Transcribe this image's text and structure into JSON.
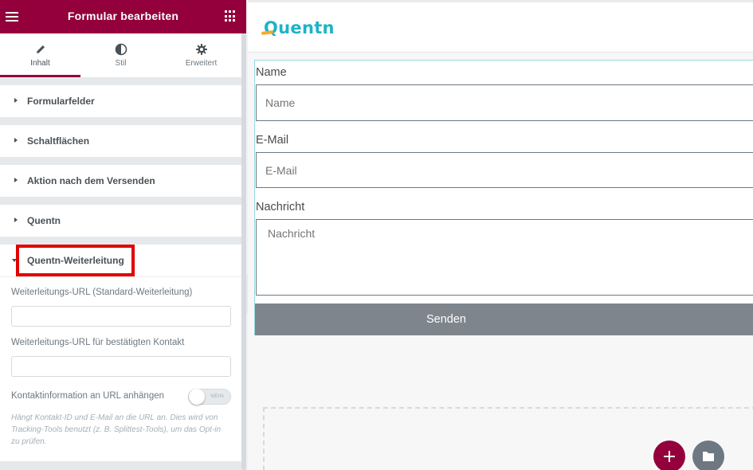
{
  "sidebar": {
    "title": "Formular bearbeiten",
    "tabs": [
      {
        "label": "Inhalt",
        "icon": "pencil-icon",
        "active": true
      },
      {
        "label": "Stil",
        "icon": "contrast-icon",
        "active": false
      },
      {
        "label": "Erweitert",
        "icon": "gear-icon",
        "active": false
      }
    ],
    "sections": [
      {
        "label": "Formularfelder",
        "expanded": false
      },
      {
        "label": "Schaltflächen",
        "expanded": false
      },
      {
        "label": "Aktion nach dem Versenden",
        "expanded": false
      },
      {
        "label": "Quentn",
        "expanded": false
      },
      {
        "label": "Quentn-Weiterleitung",
        "expanded": true
      }
    ],
    "panel": {
      "redirect_url_label": "Weiterleitungs-URL (Standard-Weiterleitung)",
      "redirect_url_value": "",
      "confirmed_url_label": "Weiterleitungs-URL für bestätigten Kontakt",
      "confirmed_url_value": "",
      "append_contact_label": "Kontaktinformation an URL anhängen",
      "toggle_text": "NEIN",
      "toggle_on": false,
      "hint": "Hängt Kontakt-ID und E-Mail an die URL an. Dies wird von Tracking-Tools benutzt (z. B. Splittest-Tools), um das Opt-in zu prüfen."
    }
  },
  "preview": {
    "logo_text": "Quentn",
    "form": {
      "fields": [
        {
          "label": "Name",
          "placeholder": "Name"
        },
        {
          "label": "E-Mail",
          "placeholder": "E-Mail"
        },
        {
          "label": "Nachricht",
          "placeholder": "Nachricht"
        }
      ],
      "submit_label": "Senden"
    }
  },
  "colors": {
    "brand": "#93003c",
    "highlight": "#e00000",
    "logo": "#1eb3c7",
    "logo_accent": "#f7a823",
    "submit_bg": "#7e858d"
  }
}
